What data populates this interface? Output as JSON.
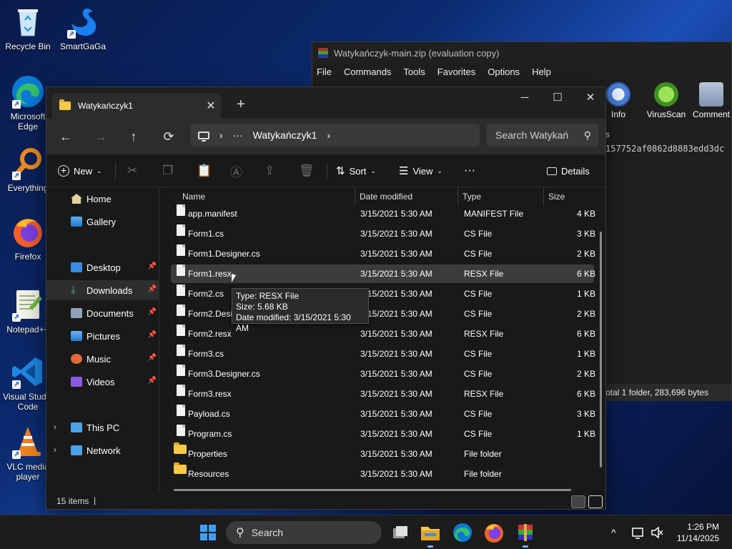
{
  "desktop": {
    "icons": [
      {
        "label": "Recycle Bin"
      },
      {
        "label": "SmartGaGa"
      },
      {
        "label": "Microsoft Edge"
      },
      {
        "label": "Everything"
      },
      {
        "label": "Firefox"
      },
      {
        "label": "Notepad++"
      },
      {
        "label": "Visual Studio Code"
      },
      {
        "label": "VLC media player"
      }
    ]
  },
  "winrar": {
    "title": "Watykańczyk-main.zip (evaluation copy)",
    "menu": [
      "File",
      "Commands",
      "Tools",
      "Favorites",
      "Options",
      "Help"
    ],
    "toolbar": [
      {
        "label": "Info",
        "icon": "info-icon"
      },
      {
        "label": "VirusScan",
        "icon": "virus-scan-icon"
      },
      {
        "label": "Comment",
        "icon": "comment-icon"
      }
    ],
    "address_fragment": "s",
    "hash_fragment": "157752af0862d8883edd3dc",
    "status": "otal 1 folder, 283,696 bytes"
  },
  "explorer": {
    "tab_title": "Watykańczyk1",
    "tab_close": "✕",
    "new_tab": "+",
    "window_controls": {
      "minimize": "─",
      "maximize": "☐",
      "close": "✕"
    },
    "nav": {
      "back": "←",
      "forward": "→",
      "up": "↑",
      "refresh": "⟳"
    },
    "breadcrumb": {
      "more": "···",
      "current": "Watykańczyk1",
      "chevron": "›"
    },
    "search_placeholder": "Search Watykań",
    "commands": {
      "new": "New",
      "sort": "Sort",
      "view": "View",
      "more": "···",
      "details": "Details"
    },
    "sidebar": [
      {
        "label": "Home",
        "icon": "home-icon",
        "pinned": false
      },
      {
        "label": "Gallery",
        "icon": "gallery-icon",
        "pinned": false
      },
      {
        "label": "Desktop",
        "icon": "desktop-icon",
        "pinned": true
      },
      {
        "label": "Downloads",
        "icon": "download-icon",
        "pinned": true
      },
      {
        "label": "Documents",
        "icon": "documents-icon",
        "pinned": true
      },
      {
        "label": "Pictures",
        "icon": "pictures-icon",
        "pinned": true
      },
      {
        "label": "Music",
        "icon": "music-icon",
        "pinned": true
      },
      {
        "label": "Videos",
        "icon": "videos-icon",
        "pinned": true
      },
      {
        "label": "This PC",
        "icon": "pc-icon",
        "pinned": false
      },
      {
        "label": "Network",
        "icon": "network-icon",
        "pinned": false
      }
    ],
    "columns": [
      "Name",
      "Date modified",
      "Type",
      "Size"
    ],
    "files": [
      {
        "name": "app.manifest",
        "date": "3/15/2021 5:30 AM",
        "type": "MANIFEST File",
        "size": "4 KB",
        "kind": "file"
      },
      {
        "name": "Form1.cs",
        "date": "3/15/2021 5:30 AM",
        "type": "CS File",
        "size": "3 KB",
        "kind": "file"
      },
      {
        "name": "Form1.Designer.cs",
        "date": "3/15/2021 5:30 AM",
        "type": "CS File",
        "size": "2 KB",
        "kind": "file"
      },
      {
        "name": "Form1.resx",
        "date": "3/15/2021 5:30 AM",
        "type": "RESX File",
        "size": "6 KB",
        "kind": "file"
      },
      {
        "name": "Form2.cs",
        "date": "3/15/2021 5:30 AM",
        "type": "CS File",
        "size": "1 KB",
        "kind": "file"
      },
      {
        "name": "Form2.Designer.cs",
        "date": "3/15/2021 5:30 AM",
        "type": "CS File",
        "size": "2 KB",
        "kind": "file"
      },
      {
        "name": "Form2.resx",
        "date": "3/15/2021 5:30 AM",
        "type": "RESX File",
        "size": "6 KB",
        "kind": "file"
      },
      {
        "name": "Form3.cs",
        "date": "3/15/2021 5:30 AM",
        "type": "CS File",
        "size": "1 KB",
        "kind": "file"
      },
      {
        "name": "Form3.Designer.cs",
        "date": "3/15/2021 5:30 AM",
        "type": "CS File",
        "size": "2 KB",
        "kind": "file"
      },
      {
        "name": "Form3.resx",
        "date": "3/15/2021 5:30 AM",
        "type": "RESX File",
        "size": "6 KB",
        "kind": "file"
      },
      {
        "name": "Payload.cs",
        "date": "3/15/2021 5:30 AM",
        "type": "CS File",
        "size": "3 KB",
        "kind": "file"
      },
      {
        "name": "Program.cs",
        "date": "3/15/2021 5:30 AM",
        "type": "CS File",
        "size": "1 KB",
        "kind": "file"
      },
      {
        "name": "Properties",
        "date": "3/15/2021 5:30 AM",
        "type": "File folder",
        "size": "",
        "kind": "folder"
      },
      {
        "name": "Resources",
        "date": "3/15/2021 5:30 AM",
        "type": "File folder",
        "size": "",
        "kind": "folder"
      }
    ],
    "tooltip": {
      "type": "Type: RESX File",
      "size": "Size: 5.68 KB",
      "date": "Date modified: 3/15/2021 5:30 AM"
    },
    "status": {
      "count": "15 items",
      "cursor": "|"
    }
  },
  "taskbar": {
    "search_label": "Search",
    "apps": [
      "windows-start-icon",
      "task-view-icon",
      "file-explorer-icon",
      "edge-icon",
      "firefox-icon",
      "winrar-icon"
    ],
    "tray": {
      "chevron": "^"
    },
    "clock": {
      "time": "1:26 PM",
      "date": "11/14/2025"
    }
  },
  "colors": {
    "accent": "#0a64d8",
    "folder": "#f7c948",
    "window_bg": "#191919",
    "selection": "#3c3c3c"
  }
}
